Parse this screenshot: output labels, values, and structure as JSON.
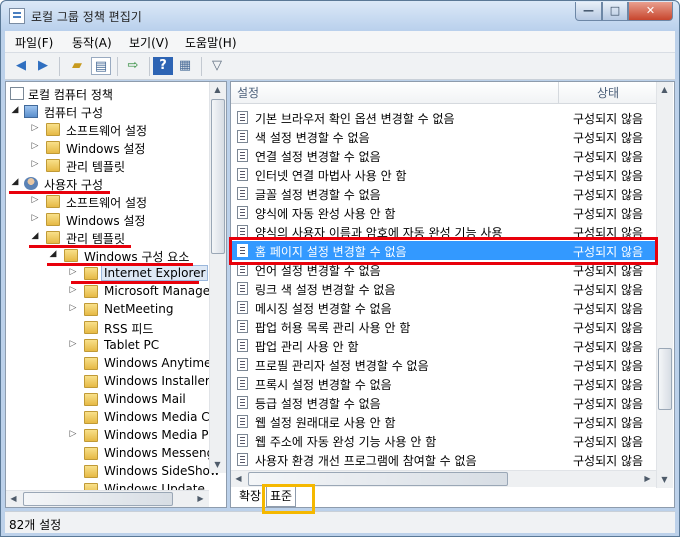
{
  "window": {
    "title": "로컬 그룹 정책 편집기"
  },
  "titlebar_buttons": {
    "minimize": "—",
    "maximize": "□",
    "close": "✕"
  },
  "menu": [
    "파일(F)",
    "동작(A)",
    "보기(V)",
    "도움말(H)"
  ],
  "toolbar_icons": [
    "back-arrow-icon",
    "forward-arrow-icon",
    "up-folder-icon",
    "show-tree-icon",
    "export-list-icon",
    "help-icon",
    "properties-icon",
    "filter-icon"
  ],
  "tree": [
    {
      "label": "로컬 컴퓨터 정책",
      "icon": "document-icon",
      "expander": ""
    },
    {
      "label": "컴퓨터 구성",
      "icon": "computer-icon",
      "expander": "◢"
    },
    {
      "label": "소프트웨어 설정",
      "icon": "folder-icon",
      "expander": "▷"
    },
    {
      "label": "Windows 설정",
      "icon": "folder-icon",
      "expander": "▷"
    },
    {
      "label": "관리 템플릿",
      "icon": "folder-icon",
      "expander": "▷"
    },
    {
      "label": "사용자 구성",
      "icon": "user-icon",
      "expander": "◢"
    },
    {
      "label": "소프트웨어 설정",
      "icon": "folder-icon",
      "expander": "▷"
    },
    {
      "label": "Windows 설정",
      "icon": "folder-icon",
      "expander": "▷"
    },
    {
      "label": "관리 템플릿",
      "icon": "folder-icon",
      "expander": "◢"
    },
    {
      "label": "Windows 구성 요소",
      "icon": "folder-icon",
      "expander": "◢"
    },
    {
      "label": "Internet Explorer",
      "icon": "folder-icon",
      "expander": "▷",
      "selected": true
    },
    {
      "label": "Microsoft Manager",
      "icon": "folder-icon",
      "expander": "▷"
    },
    {
      "label": "NetMeeting",
      "icon": "folder-icon",
      "expander": "▷"
    },
    {
      "label": "RSS 피드",
      "icon": "folder-icon",
      "expander": ""
    },
    {
      "label": "Tablet PC",
      "icon": "folder-icon",
      "expander": "▷"
    },
    {
      "label": "Windows Anytime",
      "icon": "folder-icon",
      "expander": ""
    },
    {
      "label": "Windows Installer",
      "icon": "folder-icon",
      "expander": ""
    },
    {
      "label": "Windows Mail",
      "icon": "folder-icon",
      "expander": ""
    },
    {
      "label": "Windows Media Ce",
      "icon": "folder-icon",
      "expander": ""
    },
    {
      "label": "Windows Media Pla",
      "icon": "folder-icon",
      "expander": "▷"
    },
    {
      "label": "Windows Messenge",
      "icon": "folder-icon",
      "expander": ""
    },
    {
      "label": "Windows SideShow",
      "icon": "folder-icon",
      "expander": ""
    },
    {
      "label": "Windows Update",
      "icon": "folder-icon",
      "expander": ""
    }
  ],
  "list": {
    "columns": {
      "setting": "설정",
      "state": "상태"
    },
    "rows": [
      {
        "name": "기본 브라우저 확인 옵션 변경할 수 없음",
        "state": "구성되지 않음"
      },
      {
        "name": "색 설정 변경할 수 없음",
        "state": "구성되지 않음"
      },
      {
        "name": "연결 설정 변경할 수 없음",
        "state": "구성되지 않음"
      },
      {
        "name": "인터넷 연결 마법사 사용 안 함",
        "state": "구성되지 않음"
      },
      {
        "name": "글꼴 설정 변경할 수 없음",
        "state": "구성되지 않음"
      },
      {
        "name": "양식에 자동 완성 사용 안 함",
        "state": "구성되지 않음"
      },
      {
        "name": "양식의 사용자 이름과 암호에 자동 완성 기능 사용",
        "state": "구성되지 않음"
      },
      {
        "name": "홈 페이지 설정 변경할 수 없음",
        "state": "구성되지 않음",
        "selected": true
      },
      {
        "name": "언어 설정 변경할 수 없음",
        "state": "구성되지 않음"
      },
      {
        "name": "링크 색 설정 변경할 수 없음",
        "state": "구성되지 않음"
      },
      {
        "name": "메시징 설정 변경할 수 없음",
        "state": "구성되지 않음"
      },
      {
        "name": "팝업 허용 목록 관리 사용 안 함",
        "state": "구성되지 않음"
      },
      {
        "name": "팝업 관리 사용 안 함",
        "state": "구성되지 않음"
      },
      {
        "name": "프로필 관리자 설정 변경할 수 없음",
        "state": "구성되지 않음"
      },
      {
        "name": "프록시 설정 변경할 수 없음",
        "state": "구성되지 않음"
      },
      {
        "name": "등급 설정 변경할 수 없음",
        "state": "구성되지 않음"
      },
      {
        "name": "웹 설정 원래대로 사용 안 함",
        "state": "구성되지 않음"
      },
      {
        "name": "웹 주소에 자동 완성 기능 사용 안 함",
        "state": "구성되지 않음"
      },
      {
        "name": "사용자 환경 개선 프로그램에 참여할 수 없음",
        "state": "구성되지 않음"
      }
    ]
  },
  "tabs": {
    "extended": "확장",
    "standard": "표준"
  },
  "status": {
    "text": "82개 설정"
  },
  "colors": {
    "selection": "#3399ff",
    "highlight_red": "#e8000b",
    "highlight_orange": "#f5b800"
  }
}
